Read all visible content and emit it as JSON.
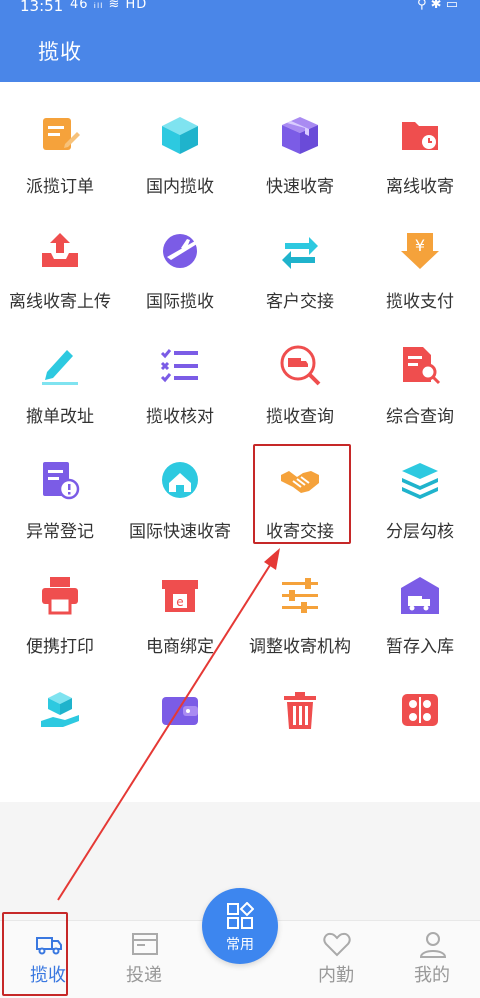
{
  "status": {
    "time": "13:51",
    "signal": "46 ᵢₗₗ  ≋ HD",
    "right_icons": "⚲ ✱ ▭"
  },
  "header": {
    "title": "揽收"
  },
  "grid": [
    {
      "label": "派揽订单",
      "icon": "clipboard-edit-icon"
    },
    {
      "label": "国内揽收",
      "icon": "box-cube-icon"
    },
    {
      "label": "快速收寄",
      "icon": "parcel-box-icon"
    },
    {
      "label": "离线收寄",
      "icon": "folder-clock-icon"
    },
    {
      "label": "离线收寄上传",
      "icon": "upload-tray-icon"
    },
    {
      "label": "国际揽收",
      "icon": "plane-globe-icon"
    },
    {
      "label": "客户交接",
      "icon": "swap-arrows-icon"
    },
    {
      "label": "揽收支付",
      "icon": "yen-down-icon"
    },
    {
      "label": "撤单改址",
      "icon": "pencil-edit-icon"
    },
    {
      "label": "揽收核对",
      "icon": "checklist-icon"
    },
    {
      "label": "揽收查询",
      "icon": "truck-search-icon"
    },
    {
      "label": "综合查询",
      "icon": "document-search-icon"
    },
    {
      "label": "异常登记",
      "icon": "document-alert-icon"
    },
    {
      "label": "国际快速收寄",
      "icon": "globe-house-icon"
    },
    {
      "label": "收寄交接",
      "icon": "handshake-icon"
    },
    {
      "label": "分层勾核",
      "icon": "layers-icon"
    },
    {
      "label": "便携打印",
      "icon": "printer-icon"
    },
    {
      "label": "电商绑定",
      "icon": "shop-icon"
    },
    {
      "label": "调整收寄机构",
      "icon": "sliders-icon"
    },
    {
      "label": "暂存入库",
      "icon": "warehouse-truck-icon"
    },
    {
      "label": "",
      "icon": "hand-box-icon"
    },
    {
      "label": "",
      "icon": "wallet-icon"
    },
    {
      "label": "",
      "icon": "trash-icon"
    },
    {
      "label": "",
      "icon": "transfer-icon"
    }
  ],
  "tabs": [
    {
      "label": "揽收",
      "icon": "truck-icon",
      "active": true
    },
    {
      "label": "投递",
      "icon": "card-icon",
      "active": false
    },
    {
      "label": "常用",
      "icon": "grid-diamond-icon",
      "active": false
    },
    {
      "label": "内勤",
      "icon": "heart-icon",
      "active": false
    },
    {
      "label": "我的",
      "icon": "person-icon",
      "active": false
    }
  ],
  "colors": {
    "header": "#4a86e8",
    "accent_blue": "#3d86ef",
    "highlight_red": "#c62828",
    "orange": "#f5a23b",
    "cyan": "#2dc9e0",
    "purple": "#7b5ce6",
    "red": "#ef4e4e"
  }
}
